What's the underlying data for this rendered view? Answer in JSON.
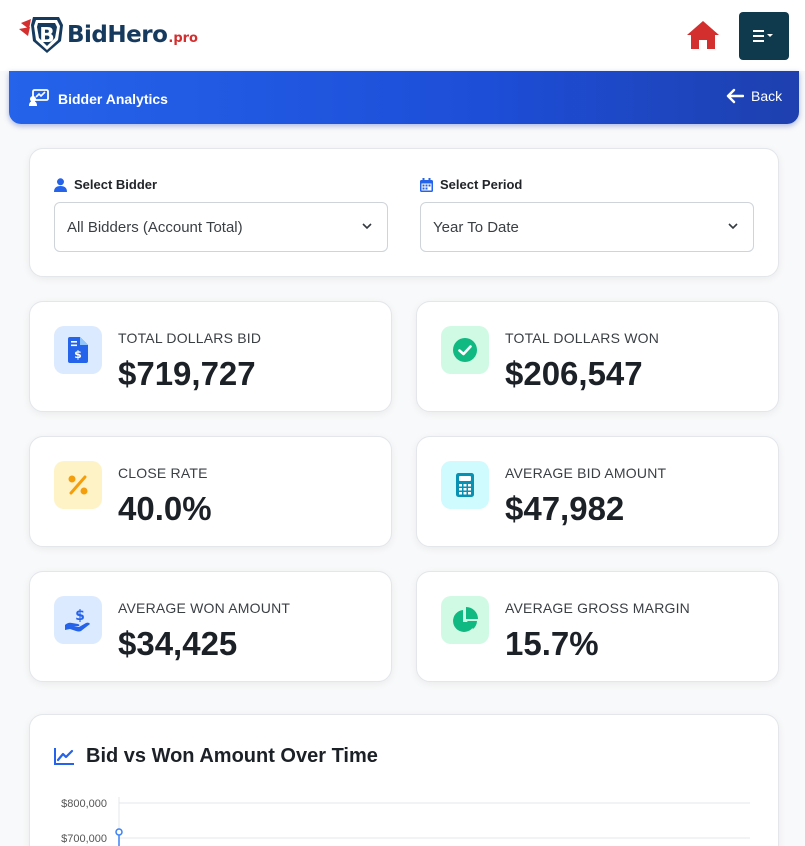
{
  "app": {
    "brand_name": "BidHero",
    "brand_suffix": ".pro",
    "brand_colors": {
      "navy": "#16395e",
      "red": "#d32f2f"
    },
    "icons": {
      "home": "home-icon",
      "menu": "hamburger-menu-icon"
    }
  },
  "header": {
    "title": "Bidder Analytics",
    "back_label": "Back",
    "icons": {
      "title": "analytics-icon",
      "back": "arrow-left-icon"
    }
  },
  "filters": {
    "bidder_label": "Select Bidder",
    "bidder_value": "All Bidders (Account Total)",
    "period_label": "Select Period",
    "period_value": "Year To Date",
    "icons": {
      "bidder": "user-icon",
      "period": "calendar-icon",
      "dropdown": "chevron-down-icon"
    }
  },
  "stats": [
    {
      "label": "TOTAL DOLLARS BID",
      "value": "$719,727",
      "icon": "invoice-dollar-icon",
      "color": "#2563eb",
      "bg": "#dbeafe"
    },
    {
      "label": "TOTAL DOLLARS WON",
      "value": "$206,547",
      "icon": "check-circle-icon",
      "color": "#10b981",
      "bg": "#d1fae5"
    },
    {
      "label": "CLOSE RATE",
      "value": "40.0%",
      "icon": "percent-icon",
      "color": "#f59e0b",
      "bg": "#fef3c7"
    },
    {
      "label": "AVERAGE BID AMOUNT",
      "value": "$47,982",
      "icon": "calculator-icon",
      "color": "#0891b2",
      "bg": "#cffafe"
    },
    {
      "label": "AVERAGE WON AMOUNT",
      "value": "$34,425",
      "icon": "hand-holding-dollar-icon",
      "color": "#2563eb",
      "bg": "#dbeafe"
    },
    {
      "label": "AVERAGE GROSS MARGIN",
      "value": "15.7%",
      "icon": "pie-chart-icon",
      "color": "#10b981",
      "bg": "#d1fae5"
    }
  ],
  "chart": {
    "title": "Bid vs Won Amount Over Time",
    "icon": "line-chart-icon"
  },
  "chart_data": {
    "type": "line",
    "title": "Bid vs Won Amount Over Time",
    "xlabel": "",
    "ylabel": "",
    "y_tick_labels": [
      "$800,000",
      "$700,000"
    ],
    "y_ticks": [
      800000,
      700000
    ],
    "series": [
      {
        "x": [
          0
        ],
        "values": [
          720000
        ]
      }
    ],
    "grid": true,
    "colors": {
      "series": "#3b82f6"
    }
  }
}
